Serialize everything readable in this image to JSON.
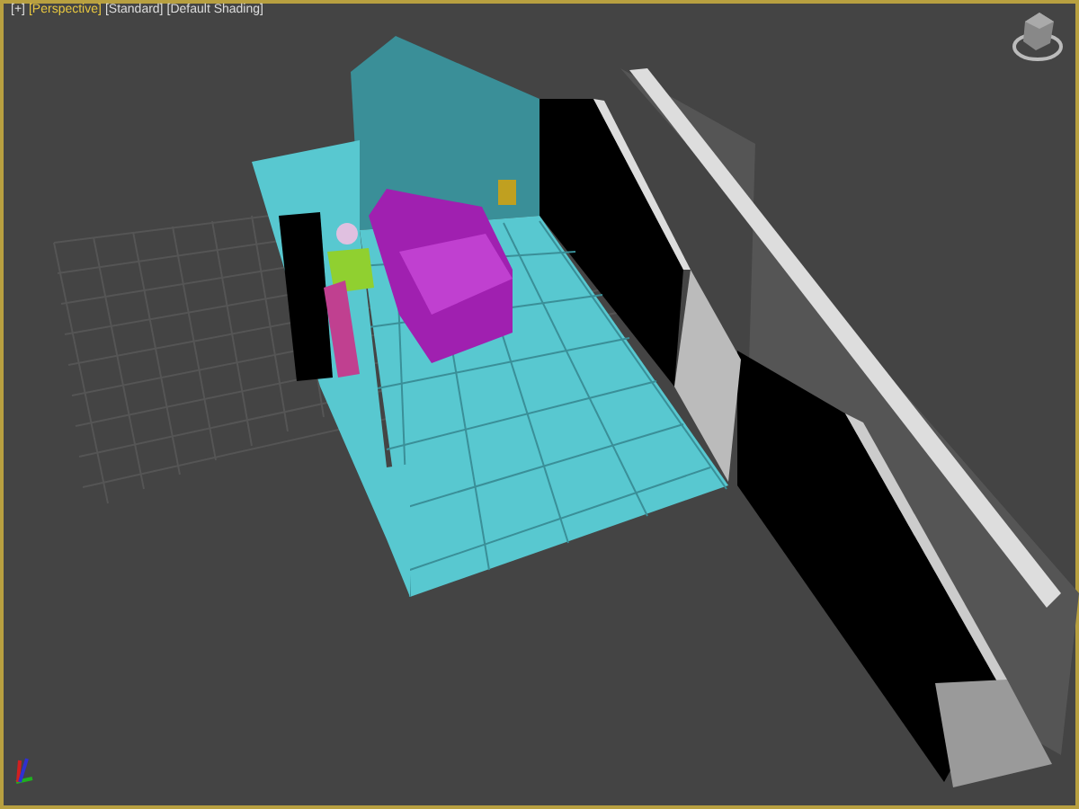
{
  "viewport": {
    "active": true,
    "labels": [
      {
        "text": "[+]",
        "highlighted": false
      },
      {
        "text": "[Perspective]",
        "highlighted": true
      },
      {
        "text": "[Standard]",
        "highlighted": false
      },
      {
        "text": "[Default Shading]",
        "highlighted": false
      }
    ]
  }
}
